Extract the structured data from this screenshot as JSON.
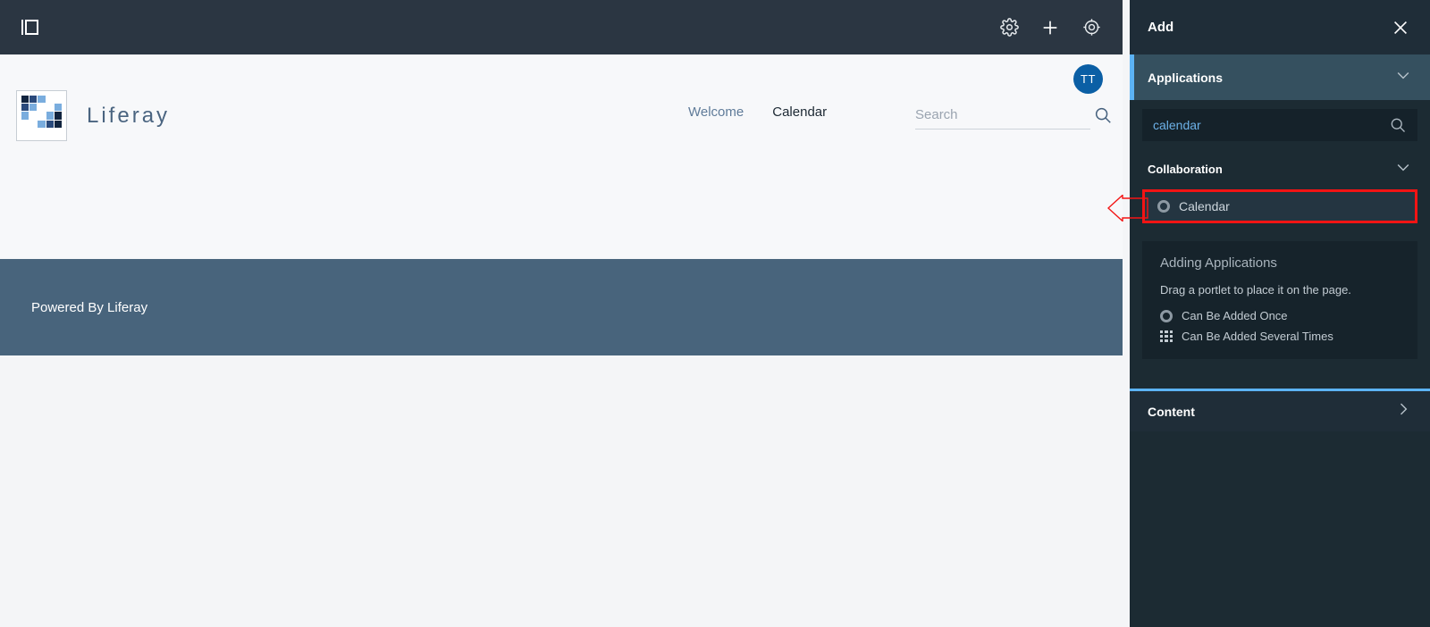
{
  "control_bar": {
    "sidebar_toggle_icon": "sidebar-toggle-icon",
    "icons": [
      {
        "name": "gear-icon",
        "label": "Settings"
      },
      {
        "name": "plus-icon",
        "label": "Add"
      },
      {
        "name": "globe-target-icon",
        "label": "Preview"
      }
    ]
  },
  "site_header": {
    "avatar_initials": "TT",
    "brand_name": "Liferay",
    "logo_name": "liferay-logo",
    "logo_colors": {
      "dark": "#11243f",
      "mid": "#2a4a7c",
      "light": "#7aadde",
      "empty": "#ffffff"
    },
    "logo_cells": [
      "dark",
      "mid",
      "light",
      "empty",
      "empty",
      "mid",
      "light",
      "empty",
      "empty",
      "light",
      "light",
      "empty",
      "empty",
      "light",
      "dark",
      "empty",
      "empty",
      "light",
      "mid",
      "dark",
      "empty",
      "empty",
      "empty",
      "empty",
      "empty"
    ],
    "nav": [
      {
        "label": "Welcome",
        "active": false
      },
      {
        "label": "Calendar",
        "active": true
      }
    ],
    "search": {
      "value": "",
      "placeholder": "Search",
      "icon": "search-icon"
    }
  },
  "footer": {
    "text": "Powered By Liferay"
  },
  "panel": {
    "title": "Add",
    "close_icon": "close-icon",
    "applications": {
      "label": "Applications",
      "chevron": "chevron-down-icon",
      "expanded": true
    },
    "search": {
      "value": "calendar",
      "placeholder": "Search",
      "icon": "search-icon"
    },
    "group": {
      "label": "Collaboration",
      "chevron": "chevron-down-icon"
    },
    "app_item": {
      "label": "Calendar",
      "icon": "can-be-added-once-icon",
      "highlighted": true,
      "highlight_color": "#f31414"
    },
    "help": {
      "title": "Adding Applications",
      "description": "Drag a portlet to place it on the page.",
      "legend": [
        {
          "icon": "ring-icon",
          "label": "Can Be Added Once"
        },
        {
          "icon": "dot-grid-icon",
          "label": "Can Be Added Several Times"
        }
      ]
    },
    "content": {
      "label": "Content",
      "chevron": "chevron-right-icon"
    }
  },
  "annotation": {
    "arrow_name": "red-callout-arrow",
    "color": "#f31414"
  }
}
